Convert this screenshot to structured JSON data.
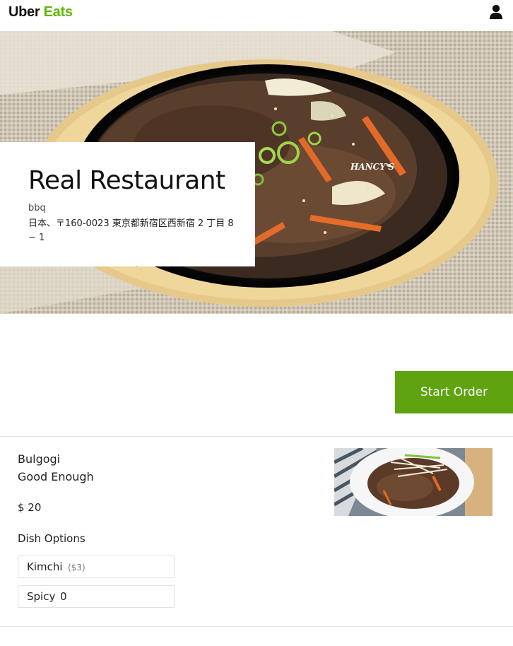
{
  "header": {
    "logo_uber": "Uber",
    "logo_eats": "Eats",
    "user_icon": "user-icon",
    "brand_color": "#5fb709"
  },
  "restaurant": {
    "name": "Real Restaurant",
    "category": "bbq",
    "address": "日本、〒160-0023 東京都新宿区西新宿 2 丁目 8 − 1",
    "photo_watermark": "HANCY'S"
  },
  "start_order": {
    "label": "Start Order",
    "color": "#5fa311"
  },
  "dish": {
    "name": "Bulgogi",
    "description": "Good Enough",
    "price": "$ 20",
    "options_title": "Dish Options",
    "options": [
      {
        "label": "Kimchi",
        "extra": "($3)"
      },
      {
        "label": "Spicy",
        "extra": "0"
      }
    ]
  }
}
